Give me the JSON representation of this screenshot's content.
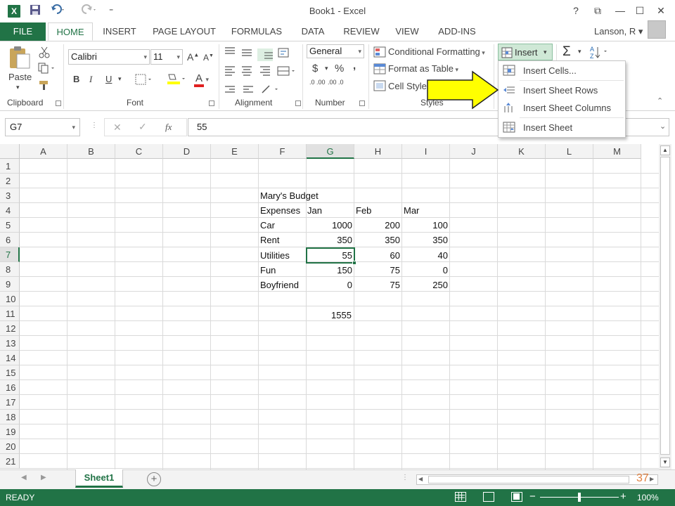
{
  "window": {
    "title": "Book1 - Excel",
    "help": "?",
    "restore_ribbon": "⧉",
    "minimize": "—",
    "maximize": "☐",
    "close": "✕"
  },
  "qat": {
    "excel_logo": "X",
    "save_icon": "save-icon",
    "undo_icon": "undo-icon",
    "redo_icon": "redo-icon",
    "customize": "⁼"
  },
  "tabs": [
    "FILE",
    "HOME",
    "INSERT",
    "PAGE LAYOUT",
    "FORMULAS",
    "DATA",
    "REVIEW",
    "VIEW",
    "ADD-INS"
  ],
  "user": {
    "name": "Lanson, R"
  },
  "ribbon": {
    "clipboard": {
      "label": "Clipboard",
      "paste": "Paste"
    },
    "font": {
      "label": "Font",
      "family": "Calibri",
      "size": "11",
      "bold": "B",
      "italic": "I",
      "underline": "U",
      "grow": "A",
      "shrink": "A",
      "font_color": "A"
    },
    "alignment": {
      "label": "Alignment"
    },
    "number": {
      "label": "Number",
      "format": "General",
      "currency": "$",
      "percent": "%",
      "comma": ",",
      "inc_dec": ".0 .00",
      "dec_dec": ".00 .0"
    },
    "styles": {
      "label": "Styles",
      "conditional": "Conditional Formatting",
      "format_table": "Format as Table",
      "cell_styles": "Cell Styles"
    },
    "cells": {
      "insert": "Insert"
    },
    "editing": {
      "sum": "Σ",
      "sort": "A Z"
    }
  },
  "insert_menu": {
    "items": [
      {
        "label": "Insert Cells...",
        "icon": "insert-cells-icon"
      },
      {
        "label": "Insert Sheet Rows",
        "icon": "insert-rows-icon"
      },
      {
        "label": "Insert Sheet Columns",
        "icon": "insert-columns-icon"
      },
      {
        "label": "Insert Sheet",
        "icon": "insert-sheet-icon"
      }
    ]
  },
  "formula_bar": {
    "name_box": "G7",
    "fx": "fx",
    "value": "55"
  },
  "grid": {
    "columns": [
      "A",
      "B",
      "C",
      "D",
      "E",
      "F",
      "G",
      "H",
      "I",
      "J",
      "K",
      "L",
      "M"
    ],
    "rows": [
      "1",
      "2",
      "3",
      "4",
      "5",
      "6",
      "7",
      "8",
      "9",
      "10",
      "11",
      "12",
      "13",
      "14",
      "15",
      "16",
      "17",
      "18",
      "19",
      "20",
      "21"
    ],
    "selected_cell": "G7",
    "cells": {
      "title": "Mary's Budget",
      "headers": [
        "Expenses",
        "Jan",
        "Feb",
        "Mar"
      ],
      "data": [
        {
          "label": "Car",
          "jan": "1000",
          "feb": "200",
          "mar": "100"
        },
        {
          "label": "Rent",
          "jan": "350",
          "feb": "350",
          "mar": "350"
        },
        {
          "label": "Utilities",
          "jan": "55",
          "feb": "60",
          "mar": "40"
        },
        {
          "label": "Fun",
          "jan": "150",
          "feb": "75",
          "mar": "0"
        },
        {
          "label": "Boyfriend",
          "jan": "0",
          "feb": "75",
          "mar": "250"
        }
      ],
      "total": "1555"
    }
  },
  "sheets": {
    "active": "Sheet1",
    "add": "+"
  },
  "slide_number": "37",
  "status": {
    "mode": "READY",
    "zoom": "100%",
    "zoom_minus": "−",
    "zoom_plus": "+"
  },
  "colors": {
    "excel_green": "#217346",
    "arrow_yellow": "#ffff00"
  }
}
